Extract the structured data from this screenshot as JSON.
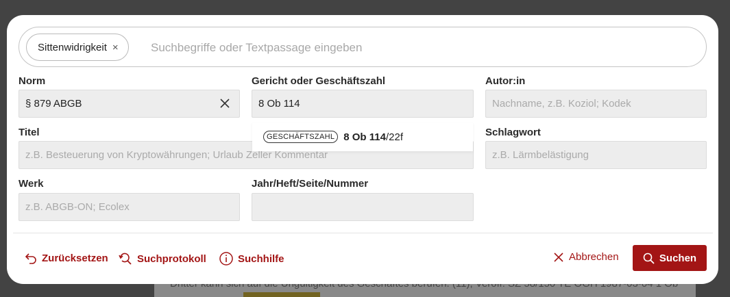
{
  "background": {
    "text": "Dritter kann sich auf die Ungültigkeit des Geschäftes berufen. (11); Veröff: SZ 58/150 TE OGH 1987-03-04 1 Ob"
  },
  "search": {
    "chip_label": "Sittenwidrigkeit",
    "chip_remove": "×",
    "placeholder": "Suchbegriffe oder Textpassage eingeben",
    "value": ""
  },
  "fields": {
    "norm": {
      "label": "Norm",
      "value": "§ 879 ABGB",
      "placeholder": ""
    },
    "gericht": {
      "label": "Gericht oder Geschäftszahl",
      "value": "8 Ob 114",
      "placeholder": ""
    },
    "autor": {
      "label": "Autor:in",
      "value": "",
      "placeholder": "Nachname, z.B. Koziol; Kodek"
    },
    "titel": {
      "label": "Titel",
      "value": "",
      "placeholder": "z.B. Besteuerung von Kryptowährungen; Urlaub Zeller Kommentar"
    },
    "schlagwort": {
      "label": "Schlagwort",
      "value": "",
      "placeholder": "z.B. Lärmbelästigung"
    },
    "werk": {
      "label": "Werk",
      "value": "",
      "placeholder": "z.B. ABGB-ON; Ecolex"
    },
    "jahr": {
      "label": "Jahr/Heft/Seite/Nummer",
      "value": "",
      "placeholder": ""
    }
  },
  "suggestion": {
    "badge": "GESCHÄFTSZAHL",
    "match": "8 Ob 114",
    "rest": "/22f"
  },
  "actions": {
    "reset": "Zurücksetzen",
    "protocol": "Suchprotokoll",
    "help": "Suchhilfe",
    "cancel": "Abbrechen",
    "search": "Suchen"
  },
  "colors": {
    "accent": "#a31515",
    "field_bg": "#ededed"
  }
}
